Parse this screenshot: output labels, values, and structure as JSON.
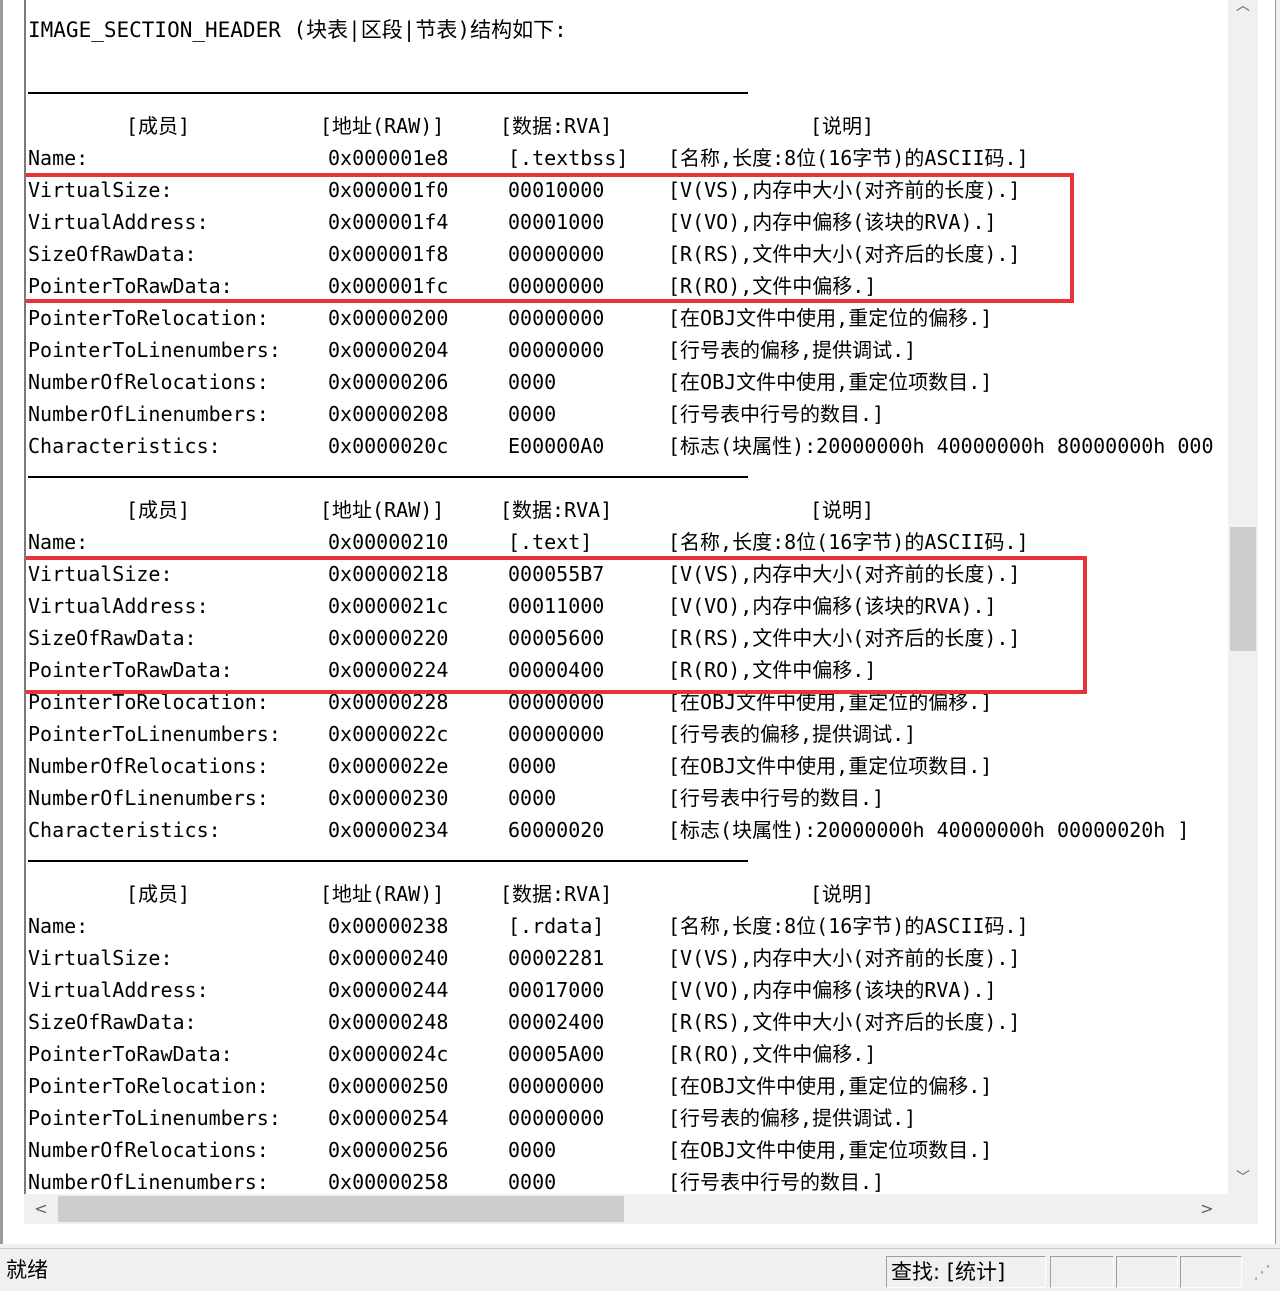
{
  "title": "IMAGE_SECTION_HEADER (块表|区段|节表)结构如下:",
  "columns": {
    "member": "[成员]",
    "address": "[地址(RAW)]",
    "data": "[数据:RVA]",
    "desc": "[说明]"
  },
  "sections": [
    {
      "rows": [
        {
          "member": "Name:",
          "address": "0x000001e8",
          "data": "[.textbss]",
          "desc": "[名称,长度:8位(16字节)的ASCII码.]"
        },
        {
          "member": "VirtualSize:",
          "address": "0x000001f0",
          "data": "00010000",
          "desc": "[V(VS),内存中大小(对齐前的长度).]"
        },
        {
          "member": "VirtualAddress:",
          "address": "0x000001f4",
          "data": "00001000",
          "desc": "[V(VO),内存中偏移(该块的RVA).]"
        },
        {
          "member": "SizeOfRawData:",
          "address": "0x000001f8",
          "data": "00000000",
          "desc": "[R(RS),文件中大小(对齐后的长度).]"
        },
        {
          "member": "PointerToRawData:",
          "address": "0x000001fc",
          "data": "00000000",
          "desc": "[R(RO),文件中偏移.]"
        },
        {
          "member": "PointerToRelocation:",
          "address": "0x00000200",
          "data": "00000000",
          "desc": "[在OBJ文件中使用,重定位的偏移.]"
        },
        {
          "member": "PointerToLinenumbers:",
          "address": "0x00000204",
          "data": "00000000",
          "desc": "[行号表的偏移,提供调试.]"
        },
        {
          "member": "NumberOfRelocations:",
          "address": "0x00000206",
          "data": "0000",
          "desc": "[在OBJ文件中使用,重定位项数目.]"
        },
        {
          "member": "NumberOfLinenumbers:",
          "address": "0x00000208",
          "data": "0000",
          "desc": "[行号表中行号的数目.]"
        },
        {
          "member": "Characteristics:",
          "address": "0x0000020c",
          "data": "E00000A0",
          "desc": "[标志(块属性):20000000h 40000000h 80000000h 000"
        }
      ]
    },
    {
      "rows": [
        {
          "member": "Name:",
          "address": "0x00000210",
          "data": "[.text]",
          "desc": "[名称,长度:8位(16字节)的ASCII码.]"
        },
        {
          "member": "VirtualSize:",
          "address": "0x00000218",
          "data": "000055B7",
          "desc": "[V(VS),内存中大小(对齐前的长度).]"
        },
        {
          "member": "VirtualAddress:",
          "address": "0x0000021c",
          "data": "00011000",
          "desc": "[V(VO),内存中偏移(该块的RVA).]"
        },
        {
          "member": "SizeOfRawData:",
          "address": "0x00000220",
          "data": "00005600",
          "desc": "[R(RS),文件中大小(对齐后的长度).]"
        },
        {
          "member": "PointerToRawData:",
          "address": "0x00000224",
          "data": "00000400",
          "desc": "[R(RO),文件中偏移.]"
        },
        {
          "member": "PointerToRelocation:",
          "address": "0x00000228",
          "data": "00000000",
          "desc": "[在OBJ文件中使用,重定位的偏移.]"
        },
        {
          "member": "PointerToLinenumbers:",
          "address": "0x0000022c",
          "data": "00000000",
          "desc": "[行号表的偏移,提供调试.]"
        },
        {
          "member": "NumberOfRelocations:",
          "address": "0x0000022e",
          "data": "0000",
          "desc": "[在OBJ文件中使用,重定位项数目.]"
        },
        {
          "member": "NumberOfLinenumbers:",
          "address": "0x00000230",
          "data": "0000",
          "desc": "[行号表中行号的数目.]"
        },
        {
          "member": "Characteristics:",
          "address": "0x00000234",
          "data": "60000020",
          "desc": "[标志(块属性):20000000h 40000000h 00000020h ]"
        }
      ]
    },
    {
      "rows": [
        {
          "member": "Name:",
          "address": "0x00000238",
          "data": "[.rdata]",
          "desc": "[名称,长度:8位(16字节)的ASCII码.]"
        },
        {
          "member": "VirtualSize:",
          "address": "0x00000240",
          "data": "00002281",
          "desc": "[V(VS),内存中大小(对齐前的长度).]"
        },
        {
          "member": "VirtualAddress:",
          "address": "0x00000244",
          "data": "00017000",
          "desc": "[V(VO),内存中偏移(该块的RVA).]"
        },
        {
          "member": "SizeOfRawData:",
          "address": "0x00000248",
          "data": "00002400",
          "desc": "[R(RS),文件中大小(对齐后的长度).]"
        },
        {
          "member": "PointerToRawData:",
          "address": "0x0000024c",
          "data": "00005A00",
          "desc": "[R(RO),文件中偏移.]"
        },
        {
          "member": "PointerToRelocation:",
          "address": "0x00000250",
          "data": "00000000",
          "desc": "[在OBJ文件中使用,重定位的偏移.]"
        },
        {
          "member": "PointerToLinenumbers:",
          "address": "0x00000254",
          "data": "00000000",
          "desc": "[行号表的偏移,提供调试.]"
        },
        {
          "member": "NumberOfRelocations:",
          "address": "0x00000256",
          "data": "0000",
          "desc": "[在OBJ文件中使用,重定位项数目.]"
        },
        {
          "member": "NumberOfLinenumbers:",
          "address": "0x00000258",
          "data": "0000",
          "desc": "[行号表中行号的数目.]"
        }
      ]
    }
  ],
  "status": {
    "ready": "就绪",
    "find": "查找: [统计]",
    "grip": "⋰"
  },
  "icons": {
    "scroll_up": "︿",
    "scroll_down": "﹀",
    "scroll_left": "<",
    "scroll_right": ">"
  },
  "colors": {
    "highlight": "#e8333a"
  }
}
